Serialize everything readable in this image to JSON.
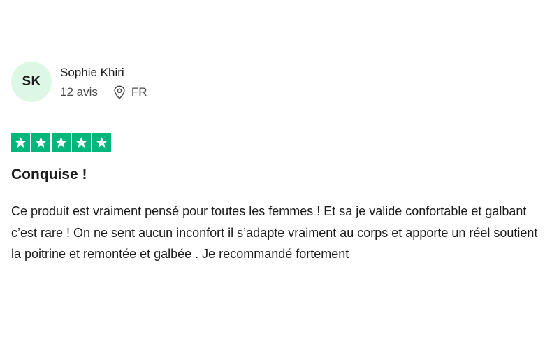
{
  "consumer": {
    "initials": "SK",
    "name": "Sophie Khiri",
    "reviews_count": "12 avis",
    "country": "FR"
  },
  "rating": {
    "stars": 5,
    "max": 5,
    "color": "#00b67a"
  },
  "review": {
    "title": "Conquise !",
    "body": "Ce produit est vraiment pensé pour toutes les femmes ! Et sa je valide confortable et galbant c’est rare ! On ne sent aucun inconfort il s’adapte vraiment au corps et apporte un réel soutient la poitrine et remontée et galbée . Je recommandé fortement"
  },
  "icons": {
    "location": "location-pin-icon",
    "star": "star-icon"
  }
}
